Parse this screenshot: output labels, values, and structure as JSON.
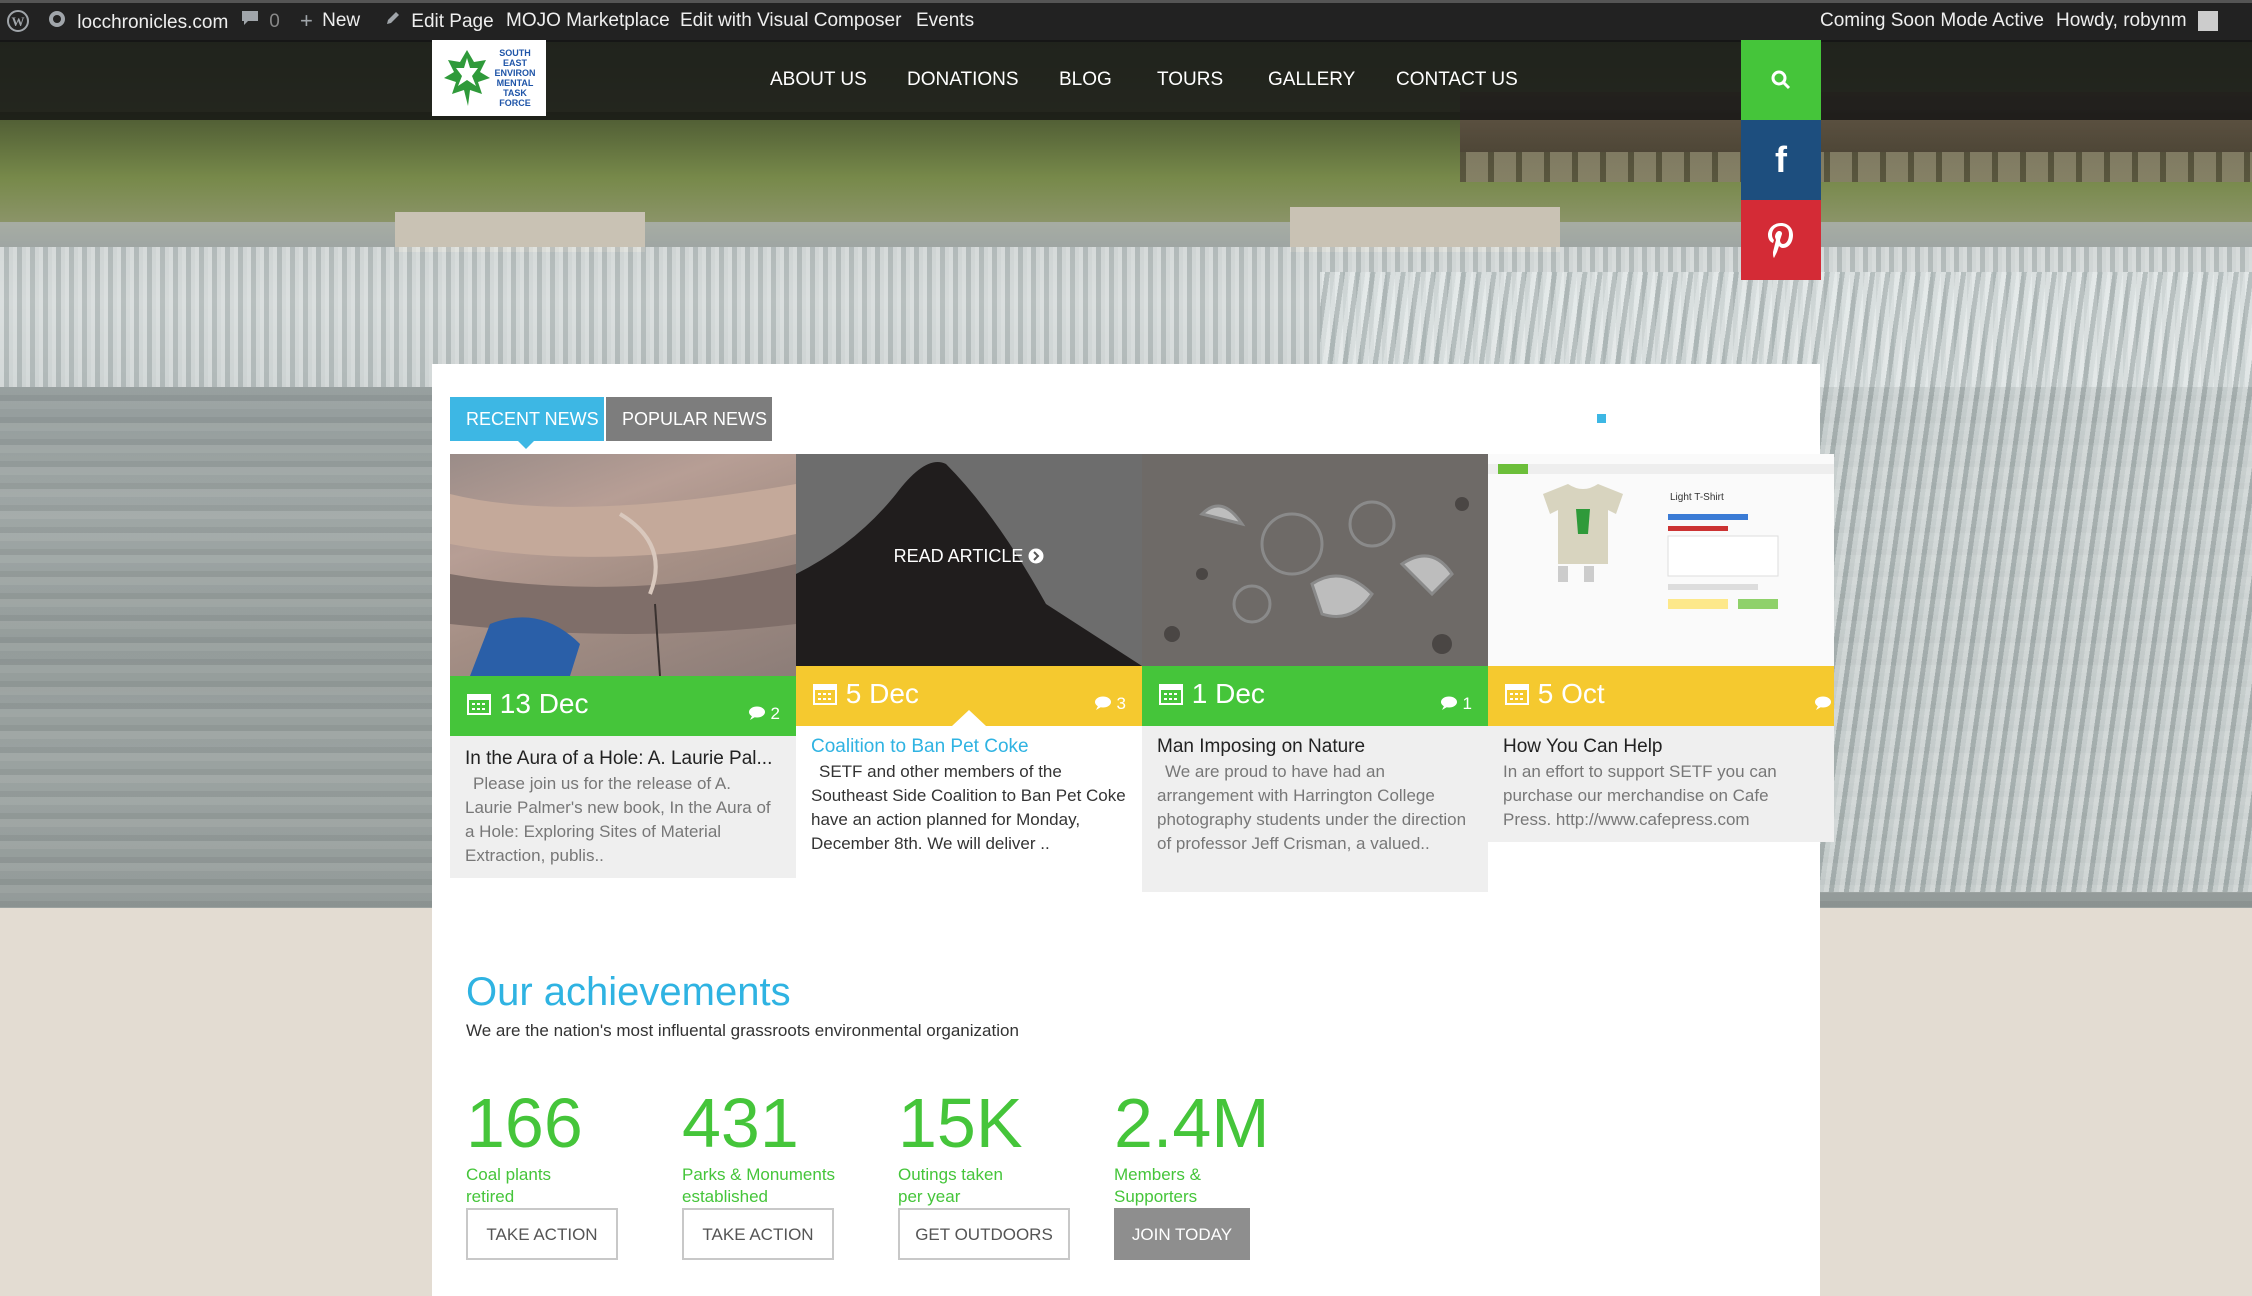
{
  "admin_bar": {
    "site": "locchronicles.com",
    "comments_count": "0",
    "new_label": "New",
    "edit_page": "Edit Page",
    "marketplace": "MOJO Marketplace",
    "visual_composer": "Edit with Visual Composer",
    "events": "Events",
    "coming_soon": "Coming Soon Mode Active",
    "howdy": "Howdy, robynm"
  },
  "logo": {
    "lines": "SOUTH EAST ENVIRON MENTAL TASK FORCE"
  },
  "nav": {
    "items": [
      "ABOUT US",
      "DONATIONS",
      "BLOG",
      "TOURS",
      "GALLERY",
      "CONTACT US"
    ]
  },
  "social": {
    "search": "search-icon",
    "facebook": "f",
    "pinterest": "P"
  },
  "colors": {
    "green": "#45c53a",
    "yellow": "#f5c92f",
    "blue": "#3db7e4",
    "facebook": "#1d4e7e",
    "pinterest": "#d42b36"
  },
  "news": {
    "tabs": [
      "RECENT NEWS",
      "POPULAR NEWS"
    ],
    "read_article": "READ ARTICLE",
    "cards": [
      {
        "date": "13 Dec",
        "comments": "2",
        "title": "In the Aura of a Hole: A. Laurie Pal...",
        "excerpt": "Please join us for the release of A. Laurie Palmer's new book, In the Aura of a Hole: Exploring Sites of Material Extraction, publis.."
      },
      {
        "date": "5 Dec",
        "comments": "3",
        "title": "Coalition to Ban Pet Coke",
        "excerpt": "SETF and other members of the Southeast Side Coalition to Ban Pet Coke have an action planned for Monday, December 8th. We will deliver .."
      },
      {
        "date": "1 Dec",
        "comments": "1",
        "title": "Man Imposing on Nature",
        "excerpt": "We are proud to have had an arrangement with Harrington College photography students under the direction of professor Jeff Crisman, a valued.."
      },
      {
        "date": "5 Oct",
        "comments": "",
        "title": "How You Can Help",
        "excerpt": "In an effort to support SETF you can purchase our merchandise on Cafe Press. http://www.cafepress.com"
      }
    ],
    "merch_label": "Light T-Shirt"
  },
  "achievements": {
    "title": "Our achievements",
    "subtitle": "We are the nation's most influental grassroots environmental organization",
    "stats": [
      {
        "number": "166",
        "label": "Coal plants retired",
        "button": "TAKE ACTION"
      },
      {
        "number": "431",
        "label": "Parks & Monuments established",
        "button": "TAKE ACTION"
      },
      {
        "number": "15K",
        "label": "Outings taken per year",
        "button": "GET OUTDOORS"
      },
      {
        "number": "2.4M",
        "label": "Members & Supporters",
        "button": "JOIN TODAY"
      }
    ]
  }
}
